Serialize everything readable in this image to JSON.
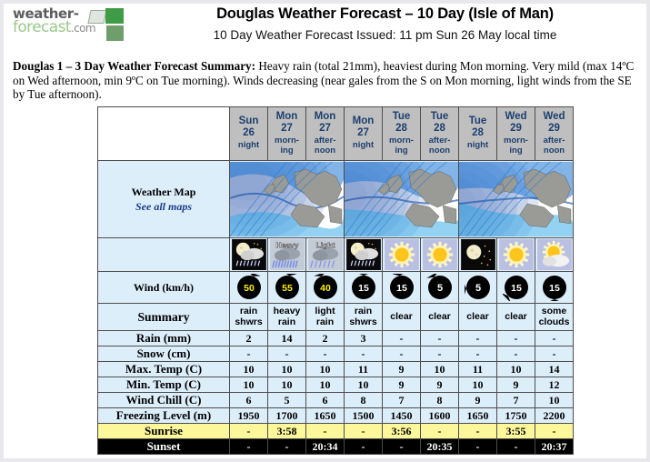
{
  "logo": {
    "line1": "weather-",
    "line2": "forecast",
    "dotcom": ".com"
  },
  "header": {
    "title": "Douglas Weather Forecast – 10 Day (Isle of Man)",
    "subtitle": "10 Day Weather Forecast Issued: 11 pm Sun 26 May local time"
  },
  "summary_paragraph": {
    "label": "Douglas 1 – 3 Day Weather Forecast Summary:",
    "text": " Heavy rain (total 21mm), heaviest during Mon morning. Very mild (max 14ºC on Wed afternoon, min 9ºC on Tue morning). Winds decreasing (near gales from the S on Mon morning, light winds from the SE by Tue afternoon)."
  },
  "table": {
    "columns": [
      {
        "day": "Sun",
        "date": "26",
        "period": "night"
      },
      {
        "day": "Mon",
        "date": "27",
        "period": "morn-ing"
      },
      {
        "day": "Mon",
        "date": "27",
        "period": "after-noon"
      },
      {
        "day": "Mon",
        "date": "27",
        "period": "night"
      },
      {
        "day": "Tue",
        "date": "28",
        "period": "morn-ing"
      },
      {
        "day": "Tue",
        "date": "28",
        "period": "after-noon"
      },
      {
        "day": "Tue",
        "date": "28",
        "period": "night"
      },
      {
        "day": "Wed",
        "date": "29",
        "period": "morn-ing"
      },
      {
        "day": "Wed",
        "date": "29",
        "period": "after-noon"
      }
    ],
    "row_labels": {
      "weather_map": "Weather Map",
      "see_all_maps": "See all maps",
      "wind": "Wind (km/h)",
      "summary": "Summary",
      "rain": "Rain (mm)",
      "snow": "Snow (cm)",
      "max_temp": "Max. Temp (C)",
      "min_temp": "Min. Temp (C)",
      "wind_chill": "Wind Chill (C)",
      "freezing_level": "Freezing Level (m)",
      "sunrise": "Sunrise",
      "sunset": "Sunset"
    },
    "weather_icons": [
      "moon-rain-showers-icon",
      "heavy-rain-icon",
      "light-rain-icon",
      "moon-rain-showers-icon",
      "sun-icon",
      "sun-icon",
      "moon-stars-icon",
      "sun-icon",
      "sun-behind-cloud-icon"
    ],
    "wind": {
      "values": [
        "50",
        "55",
        "40",
        "15",
        "15",
        "5",
        "5",
        "15",
        "15"
      ],
      "directions": [
        20,
        10,
        340,
        0,
        350,
        330,
        265,
        225,
        180
      ],
      "highlight": [
        true,
        true,
        true,
        false,
        false,
        false,
        false,
        false,
        false
      ]
    },
    "summary_text": [
      "rain shwrs",
      "heavy rain",
      "light rain",
      "rain shwrs",
      "clear",
      "clear",
      "clear",
      "clear",
      "some clouds"
    ],
    "rain_mm": [
      "2",
      "14",
      "2",
      "3",
      "-",
      "-",
      "-",
      "-",
      "-"
    ],
    "snow_cm": [
      "-",
      "-",
      "-",
      "-",
      "-",
      "-",
      "-",
      "-",
      "-"
    ],
    "max_temp_c": [
      "10",
      "10",
      "10",
      "11",
      "9",
      "10",
      "11",
      "10",
      "14"
    ],
    "max_temp_shade": [
      "g1",
      "g1",
      "g1",
      "g1",
      "g2",
      "g1",
      "g1",
      "g1",
      "g1"
    ],
    "min_temp_c": [
      "10",
      "10",
      "10",
      "10",
      "9",
      "9",
      "10",
      "9",
      "12"
    ],
    "min_temp_shade": [
      "g1",
      "g1",
      "g1",
      "g1",
      "g2",
      "g2",
      "g1",
      "g2",
      "g1"
    ],
    "wind_chill_c": [
      "6",
      "5",
      "6",
      "8",
      "7",
      "8",
      "9",
      "7",
      "10"
    ],
    "freezing_level_m": [
      "1950",
      "1700",
      "1650",
      "1500",
      "1450",
      "1600",
      "1650",
      "1750",
      "2200"
    ],
    "sunrise": [
      "-",
      "3:58",
      "-",
      "-",
      "3:56",
      "-",
      "-",
      "3:55",
      "-"
    ],
    "sunset": [
      "-",
      "-",
      "20:34",
      "-",
      "-",
      "20:35",
      "-",
      "-",
      "20:37"
    ],
    "map_groups": 3
  },
  "colors": {
    "header_cell_bg": "#bfbfbf",
    "header_text": "#1d3f6e",
    "cell_bg": "#ddeefb",
    "green_warm": "#4cf844",
    "green_cool": "#16ecb0",
    "sunrise_bg": "#fbf79a",
    "sunset_bg": "#000000",
    "rain_label": "#0a9b2e",
    "snow_label": "#e81c1c",
    "max_temp_label": "#ec1c1c",
    "min_temp_label": "#1b3fd6",
    "link": "#1b3e86"
  }
}
